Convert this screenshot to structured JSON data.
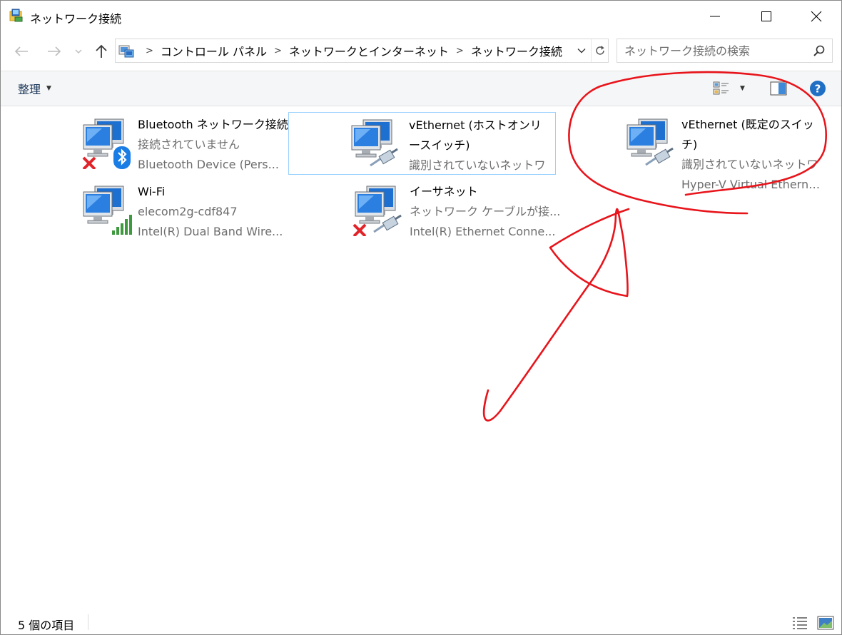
{
  "window": {
    "title": "ネットワーク接続"
  },
  "address": {
    "crumbs": [
      "コントロール パネル",
      "ネットワークとインターネット",
      "ネットワーク接続"
    ]
  },
  "search": {
    "placeholder": "ネットワーク接続の検索"
  },
  "toolbar": {
    "organize_label": "整理"
  },
  "connections": [
    {
      "name": "Bluetooth ネットワーク接続",
      "status": "接続されていません",
      "device": "Bluetooth Device (Pers...",
      "overlay": "bluetooth-icon",
      "disconnected": true,
      "selected": false
    },
    {
      "name": "vEthernet (ホストオンリースイッチ)",
      "status": "識別されていないネットワ",
      "device": "",
      "overlay": "ethernet-cable-icon",
      "disconnected": false,
      "selected": true
    },
    {
      "name": "vEthernet (既定のスイッチ)",
      "status": "識別されていないネットワ",
      "device": "Hyper-V Virtual Etherne...",
      "overlay": "ethernet-cable-icon",
      "disconnected": false,
      "selected": false
    },
    {
      "name": "Wi-Fi",
      "status": "elecom2g-cdf847",
      "device": "Intel(R) Dual Band Wire...",
      "overlay": "wifi-signal-icon",
      "disconnected": false,
      "selected": false
    },
    {
      "name": "イーサネット",
      "status": "ネットワーク ケーブルが接...",
      "device": "Intel(R) Ethernet Conne...",
      "overlay": "ethernet-cable-icon",
      "disconnected": true,
      "selected": false
    }
  ],
  "statusbar": {
    "count_text": "5 個の項目"
  },
  "colors": {
    "annotation": "#e8141b",
    "selection_border": "#99d1ff",
    "secondary_text": "#6d6d6d",
    "help": "#1f6fc4"
  }
}
